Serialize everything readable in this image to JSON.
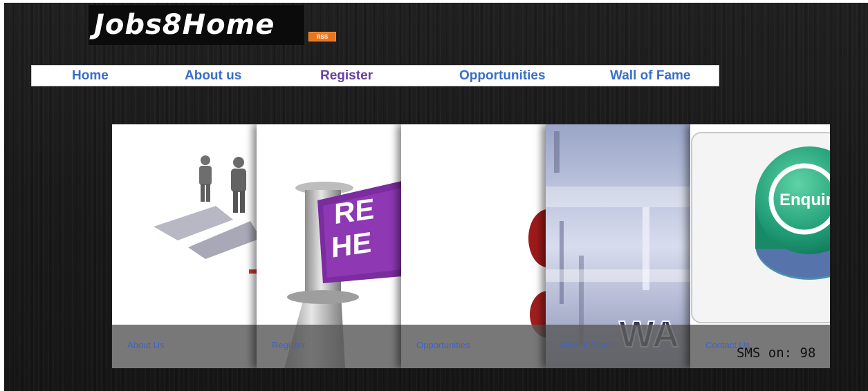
{
  "logo": {
    "text": "Jobs8Home",
    "rss_label": "RSS"
  },
  "nav": {
    "items": [
      {
        "label": "Home"
      },
      {
        "label": "About us"
      },
      {
        "label": "Register"
      },
      {
        "label": "Opportunities"
      },
      {
        "label": "Wall of Fame"
      }
    ]
  },
  "slider": {
    "panels": [
      {
        "caption": "About Us",
        "image": "people-arrows-image"
      },
      {
        "caption": "Register",
        "image": "register-here-sign-image"
      },
      {
        "caption": "Opportunities",
        "image": "opportunities-image"
      },
      {
        "caption": "Wall of Fame",
        "image": "wall-of-fame-image"
      },
      {
        "caption": "Contact Us",
        "image": "enquiry-button-image",
        "image_text": "Enquiry"
      }
    ],
    "banner_letters": {
      "register": "RE HE",
      "wall": "WA"
    }
  },
  "sms": {
    "text": "SMS on: 98"
  },
  "colors": {
    "nav_link": "#3a6fc8",
    "nav_visited": "#6a3fa0",
    "rss": "#e8761f",
    "caption_link": "#3c64c8"
  }
}
